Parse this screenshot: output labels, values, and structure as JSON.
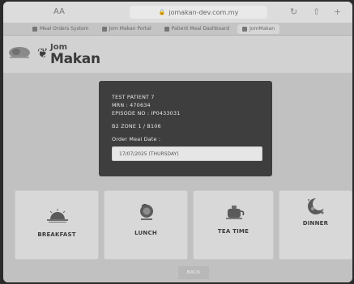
{
  "browser": {
    "font_size_control": "AA",
    "url": "jomakan-dev.com.my",
    "tabs": [
      {
        "label": "Meal Orders System"
      },
      {
        "label": "Jom Makan Portal"
      },
      {
        "label": "Patient Meal Dashboard"
      },
      {
        "label": "JomMakan"
      }
    ]
  },
  "app": {
    "brand_top": "Jom",
    "brand_bottom": "Makan"
  },
  "patient": {
    "name": "TEST PATIENT 7",
    "mrn": "MRN : 470634",
    "episode": "EPISODE NO : IP0433031",
    "location": "B2 ZONE 1 / B106",
    "order_label": "Order Meal Date :",
    "order_date": "17/07/2025 (THURSDAY)"
  },
  "meals": [
    {
      "label": "BREAKFAST",
      "icon": "sunrise-icon"
    },
    {
      "label": "LUNCH",
      "icon": "lunch-plate-icon"
    },
    {
      "label": "TEA TIME",
      "icon": "teapot-icon"
    },
    {
      "label": "DINNER",
      "icon": "moon-icon"
    }
  ],
  "footer": {
    "back_label": "BACK"
  }
}
